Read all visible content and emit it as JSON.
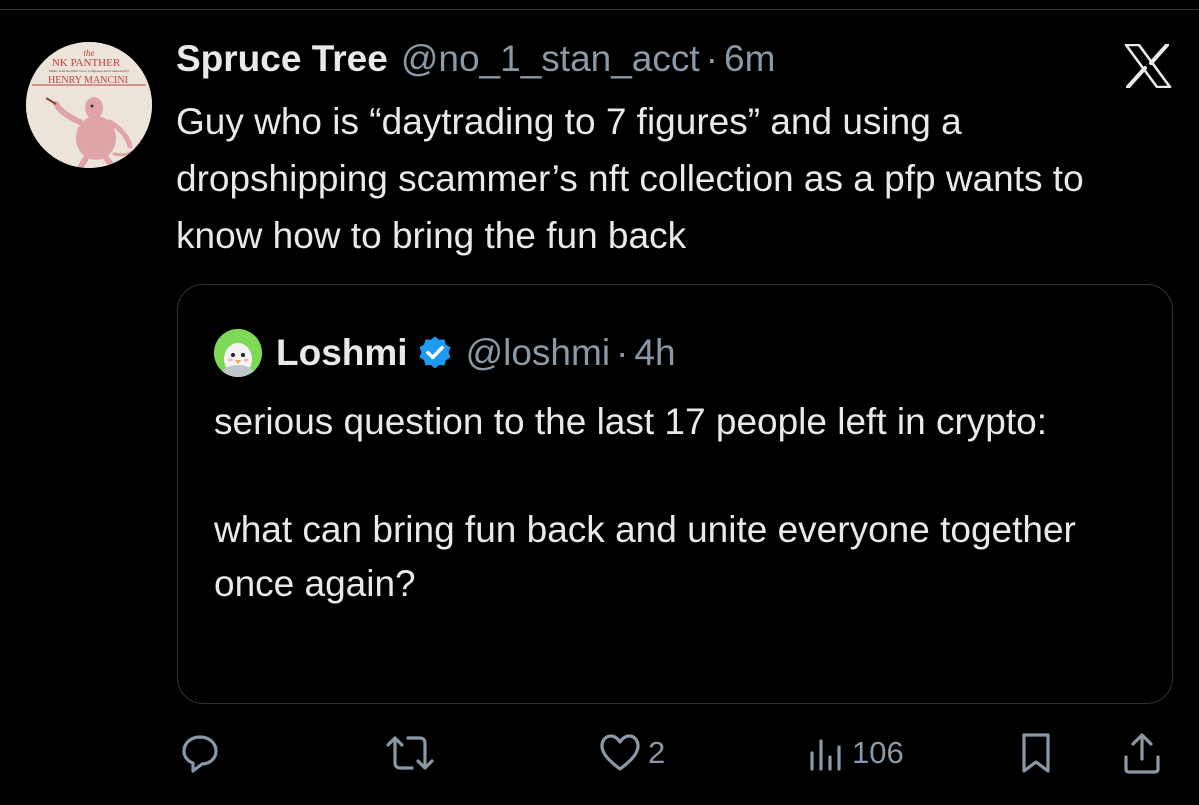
{
  "tweet": {
    "author": {
      "name": "Spruce Tree",
      "handle": "@no_1_stan_acct",
      "avatar_icon": "pink-panther-album-cover-avatar",
      "avatar_text": [
        "the",
        "NK PANTHER",
        "Music from the Film Score Composed and Conducted by",
        "HENRY MANCINI"
      ]
    },
    "separator": "·",
    "time": "6m",
    "text": "Guy who is “daytrading to 7 figures” and using a dropshipping scammer’s nft collection as a pfp wants to know how to bring the fun back"
  },
  "quote": {
    "author": {
      "name": "Loshmi",
      "handle": "@loshmi",
      "avatar_icon": "penguin-avatar",
      "verified": true
    },
    "separator": "·",
    "time": "4h",
    "paragraphs": [
      "serious question to the last 17 people left in crypto:",
      "what can bring fun back and unite everyone together once again?"
    ]
  },
  "actions": {
    "reply": {
      "icon": "reply-icon"
    },
    "retweet": {
      "icon": "retweet-icon"
    },
    "like": {
      "icon": "heart-icon",
      "count": "2"
    },
    "views": {
      "icon": "views-icon",
      "count": "106"
    },
    "bookmark": {
      "icon": "bookmark-icon"
    },
    "share": {
      "icon": "share-icon"
    }
  },
  "brand": {
    "logo": "x-logo"
  },
  "colors": {
    "background": "#000000",
    "text": "#e7e9ea",
    "secondary": "#8b98a5",
    "border": "#2f3336",
    "verified": "#1d9bf0",
    "panther_pink": "#e0a3a8"
  }
}
